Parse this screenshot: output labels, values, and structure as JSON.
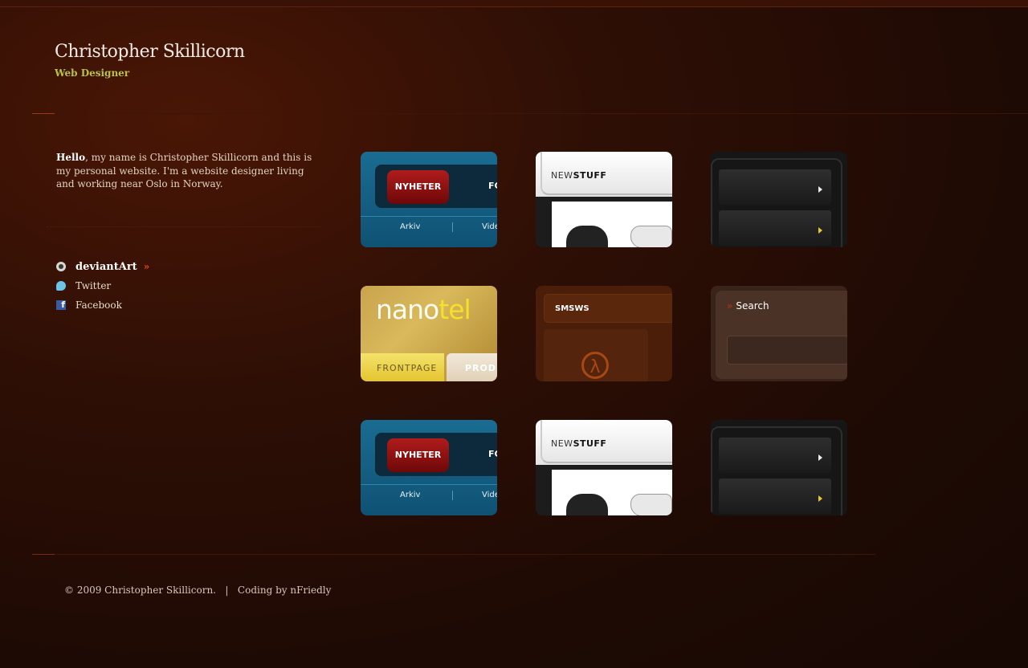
{
  "header": {
    "name": "Christopher Skillicorn",
    "role": "Web Designer"
  },
  "intro": {
    "greeting": "Hello",
    "text": ", my name is Christopher Skillicorn and this is my personal website. I'm a website designer living and working near Oslo in Norway."
  },
  "links": [
    {
      "label": "deviantArt",
      "icon": "deviantart-icon",
      "marker": "»"
    },
    {
      "label": "Twitter",
      "icon": "twitter-icon"
    },
    {
      "label": "Facebook",
      "icon": "facebook-icon"
    }
  ],
  "thumbs": {
    "blue": {
      "button": "NYHETER",
      "next": "FC",
      "sub1": "Arkiv",
      "sub2": "Vide"
    },
    "white": {
      "prefix": "NEW",
      "bold": "STUFF"
    },
    "nanotel": {
      "logo_a": "nano",
      "logo_b": "tel",
      "tab1": "FRONTPAGE",
      "tab2": "PRODUC"
    },
    "smsws": {
      "label": "SMSWS",
      "symbol": "λ"
    },
    "search": {
      "label": "Search",
      "marker": "»"
    }
  },
  "footer": {
    "text": "© 2009 Christopher Skillicorn.   |   Coding by nFriedly"
  },
  "colors": {
    "accent_green": "#b8c24a",
    "accent_red": "#e04a1a",
    "background": "#2e0f05"
  }
}
